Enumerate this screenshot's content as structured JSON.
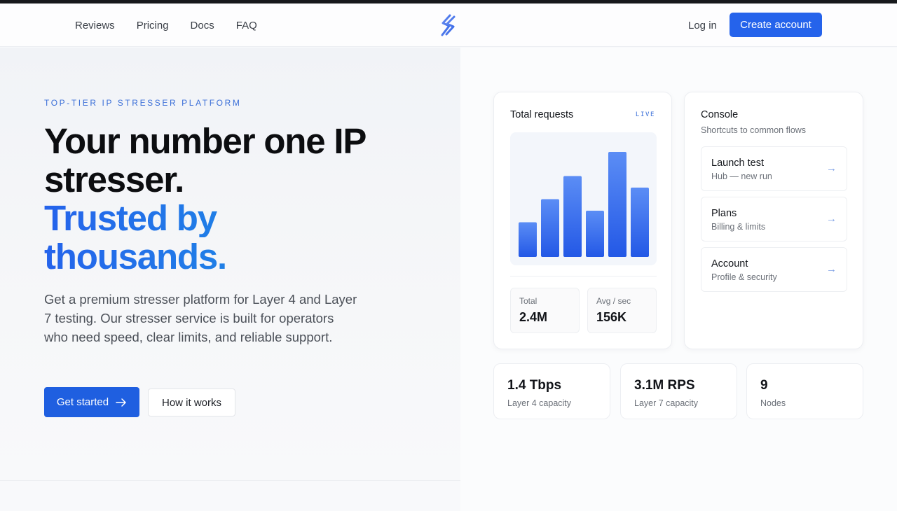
{
  "nav": {
    "links": [
      "Reviews",
      "Pricing",
      "Docs",
      "FAQ"
    ],
    "login": "Log in",
    "create_account": "Create account"
  },
  "hero": {
    "eyebrow": "TOP-TIER IP STRESSER PLATFORM",
    "headline_dark_1": "Your number one IP",
    "headline_dark_2": "stresser.",
    "headline_accent_1": "Trusted by",
    "headline_accent_2": "thousands.",
    "description": "Get a premium stresser platform for Layer 4 and Layer 7 testing. Our stresser service is built for operators who need speed, clear limits, and reliable support.",
    "primary_cta": "Get started",
    "secondary_cta": "How it works"
  },
  "requests_card": {
    "title": "Total requests",
    "badge": "LIVE",
    "bars": [
      0.33,
      0.55,
      0.77,
      0.44,
      1.0,
      0.66
    ],
    "stats": [
      {
        "label": "Total",
        "value": "2.4M"
      },
      {
        "label": "Avg / sec",
        "value": "156K"
      }
    ]
  },
  "console_card": {
    "title": "Console",
    "subtitle": "Shortcuts to common flows",
    "items": [
      {
        "title": "Launch test",
        "subtitle": "Hub — new run"
      },
      {
        "title": "Plans",
        "subtitle": "Billing & limits"
      },
      {
        "title": "Account",
        "subtitle": "Profile & security"
      }
    ]
  },
  "metrics": [
    {
      "value": "1.4 Tbps",
      "label": "Layer 4 capacity"
    },
    {
      "value": "3.1M RPS",
      "label": "Layer 7 capacity"
    },
    {
      "value": "9",
      "label": "Nodes"
    }
  ],
  "colors": {
    "accent": "#2563eb",
    "accent_light": "#1aa0ea",
    "text": "#111827",
    "muted": "#6b7078"
  },
  "icons": {
    "logo": "lightning-s-logo-icon",
    "arrow": "arrow-right-icon"
  }
}
